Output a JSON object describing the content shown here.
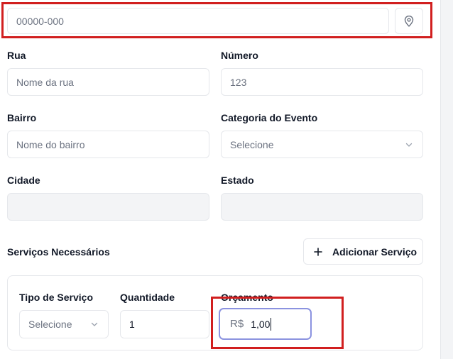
{
  "cep": {
    "placeholder": "00000-000",
    "location_icon": "map-pin-icon"
  },
  "address": {
    "rua": {
      "label": "Rua",
      "placeholder": "Nome da rua"
    },
    "numero": {
      "label": "Número",
      "placeholder": "123"
    },
    "bairro": {
      "label": "Bairro",
      "placeholder": "Nome do bairro"
    },
    "categoria": {
      "label": "Categoria do Evento",
      "selected": "Selecione"
    },
    "cidade": {
      "label": "Cidade",
      "value": ""
    },
    "estado": {
      "label": "Estado",
      "value": ""
    }
  },
  "services": {
    "title": "Serviços Necessários",
    "add_button_label": "Adicionar Serviço",
    "row": {
      "tipo_label": "Tipo de Serviço",
      "tipo_selected": "Selecione",
      "quantidade_label": "Quantidade",
      "quantidade_value": "1",
      "orcamento_label": "Orçamento",
      "orcamento_prefix": "R$",
      "orcamento_value": "1,00"
    }
  },
  "colors": {
    "annotation_red": "#d11f1f",
    "focus_border": "#8b93e0",
    "border": "#e5e7eb",
    "disabled_bg": "#f3f4f6"
  }
}
